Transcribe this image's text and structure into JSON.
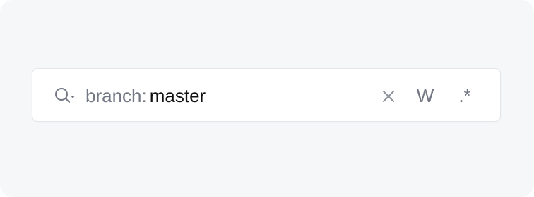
{
  "search": {
    "qualifier": "branch:",
    "value": "master",
    "actions": {
      "word_toggle_label": "W",
      "regex_toggle_label": ".*"
    },
    "icons": {
      "search_trigger": "search-with-dropdown-icon",
      "clear": "close-icon"
    }
  },
  "colors": {
    "background": "#f6f7f9",
    "field_background": "#ffffff",
    "field_border": "#e3e6ea",
    "muted_text": "#737884",
    "text": "#111111"
  }
}
